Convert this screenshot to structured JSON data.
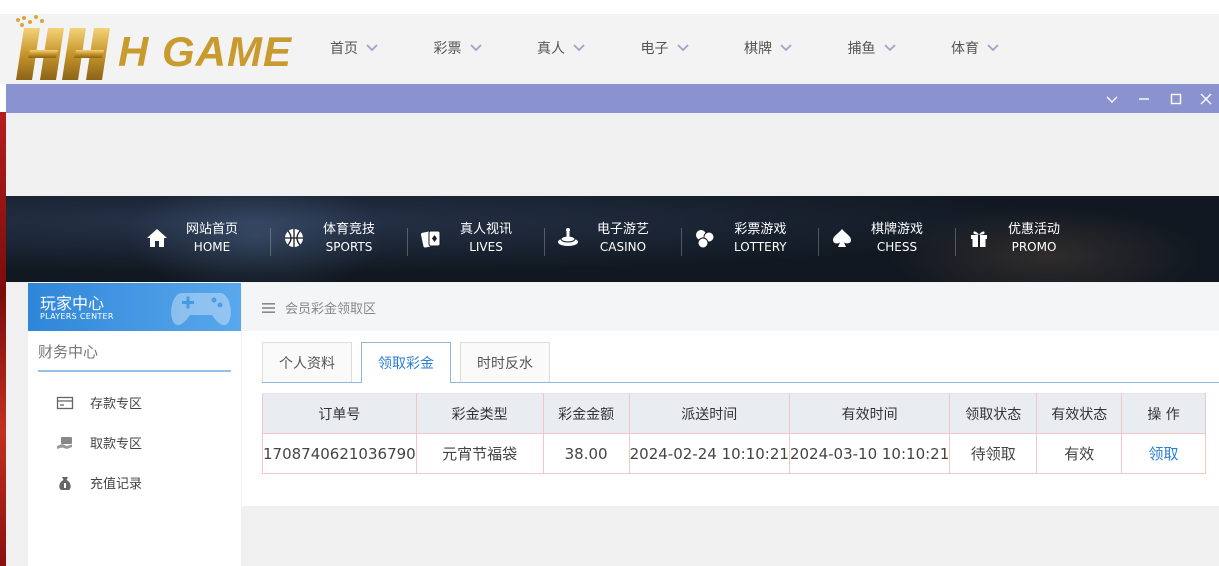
{
  "site": {
    "logo_text": "H GAME",
    "nav": [
      "首页",
      "彩票",
      "真人",
      "电子",
      "棋牌",
      "捕鱼",
      "体育"
    ]
  },
  "main_nav": [
    {
      "cn": "网站首页",
      "en": "HOME",
      "icon": "home-icon"
    },
    {
      "cn": "体育竞技",
      "en": "SPORTS",
      "icon": "basketball-icon"
    },
    {
      "cn": "真人视讯",
      "en": "LIVES",
      "icon": "cards-icon"
    },
    {
      "cn": "电子游艺",
      "en": "CASINO",
      "icon": "slot-icon"
    },
    {
      "cn": "彩票游戏",
      "en": "LOTTERY",
      "icon": "lottery-balls-icon"
    },
    {
      "cn": "棋牌游戏",
      "en": "CHESS",
      "icon": "spade-icon"
    },
    {
      "cn": "优惠活动",
      "en": "PROMO",
      "icon": "gift-icon"
    }
  ],
  "sidebar": {
    "title_cn": "玩家中心",
    "title_en": "PLAYERS CENTER",
    "section": "财务中心",
    "items": [
      {
        "label": "存款专区",
        "icon": "deposit-icon"
      },
      {
        "label": "取款专区",
        "icon": "withdraw-icon"
      },
      {
        "label": "充值记录",
        "icon": "money-bag-icon"
      }
    ]
  },
  "breadcrumb": "会员彩金领取区",
  "tabs": [
    {
      "label": "个人资料",
      "active": false
    },
    {
      "label": "领取彩金",
      "active": true
    },
    {
      "label": "时时反水",
      "active": false
    }
  ],
  "table": {
    "headers": [
      "订单号",
      "彩金类型",
      "彩金金额",
      "派送时间",
      "有效时间",
      "领取状态",
      "有效状态",
      "操 作"
    ],
    "rows": [
      [
        "1708740621036790",
        "元宵节福袋",
        "38.00",
        "2024-02-24 10:10:21",
        "2024-03-10 10:10:21",
        "待领取",
        "有效",
        "领取"
      ]
    ]
  },
  "colors": {
    "titlebar": "#8a93cf",
    "accent": "#2b7fd3",
    "logo_gold": "#c99a2e"
  }
}
